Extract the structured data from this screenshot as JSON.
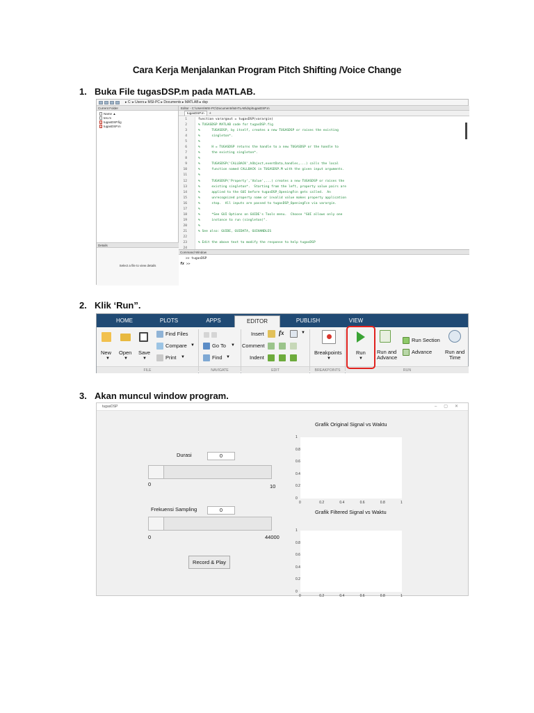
{
  "title": "Cara Kerja Menjalankan Program Pitch Shifting /Voice Change",
  "steps": [
    {
      "num": "1.",
      "text": "Buka File tugasDSP.m pada MATLAB."
    },
    {
      "num": "2.",
      "text": "Klik ‘Run”."
    },
    {
      "num": "3.",
      "text": "Akan muncul window program."
    }
  ],
  "matlab": {
    "address": "▸ C: ▸ Users ▸ MSI-PC ▸ Documents ▸ MATLAB ▸ dsp",
    "current_folder_label": "Current Folder",
    "name_header": "Name ▲",
    "files": [
      "tes.m",
      "tugasDSP.fig",
      "tugasDSP.m"
    ],
    "details_label": "Details",
    "details_msg": "Select a file to view details",
    "editor_title": "Editor - C:\\Users\\MSI-PC\\Documents\\MATLAB\\dsp\\tugasDSP.m",
    "editor_tab": "tugasDSP.m",
    "code_lines": [
      {
        "n": "1",
        "text": "function varargout = tugasDSP(varargin)",
        "kw": true
      },
      {
        "n": "2",
        "text": "% TUGASDSP MATLAB code for tugasDSP.fig",
        "kw": false
      },
      {
        "n": "3",
        "text": "%      TUGASDSP, by itself, creates a new TUGASDSP or raises the existing",
        "kw": false
      },
      {
        "n": "4",
        "text": "%      singleton*.",
        "kw": false
      },
      {
        "n": "5",
        "text": "%",
        "kw": false
      },
      {
        "n": "6",
        "text": "%      H = TUGASDSP returns the handle to a new TUGASDSP or the handle to",
        "kw": false
      },
      {
        "n": "7",
        "text": "%      the existing singleton*.",
        "kw": false
      },
      {
        "n": "8",
        "text": "%",
        "kw": false
      },
      {
        "n": "9",
        "text": "%      TUGASDSP('CALLBACK',hObject,eventData,handles,...) calls the local",
        "kw": false
      },
      {
        "n": "10",
        "text": "%      function named CALLBACK in TUGASDSP.M with the given input arguments.",
        "kw": false
      },
      {
        "n": "11",
        "text": "%",
        "kw": false
      },
      {
        "n": "12",
        "text": "%      TUGASDSP('Property','Value',...) creates a new TUGASDSP or raises the",
        "kw": false
      },
      {
        "n": "13",
        "text": "%      existing singleton*.  Starting from the left, property value pairs are",
        "kw": false
      },
      {
        "n": "14",
        "text": "%      applied to the GUI before tugasDSP_OpeningFcn gets called.  An",
        "kw": false
      },
      {
        "n": "15",
        "text": "%      unrecognized property name or invalid value makes property application",
        "kw": false
      },
      {
        "n": "16",
        "text": "%      stop.  All inputs are passed to tugasDSP_OpeningFcn via varargin.",
        "kw": false
      },
      {
        "n": "17",
        "text": "%",
        "kw": false
      },
      {
        "n": "18",
        "text": "%      *See GUI Options on GUIDE's Tools menu.  Choose \"GUI allows only one",
        "kw": false
      },
      {
        "n": "19",
        "text": "%      instance to run (singleton)\".",
        "kw": false
      },
      {
        "n": "20",
        "text": "%",
        "kw": false
      },
      {
        "n": "21",
        "text": "% See also: GUIDE, GUIDATA, GUIHANDLES",
        "kw": false
      },
      {
        "n": "22",
        "text": "",
        "kw": false
      },
      {
        "n": "23",
        "text": "% Edit the above text to modify the response to help tugasDSP",
        "kw": false
      },
      {
        "n": "24",
        "text": "",
        "kw": false
      }
    ],
    "command_window_label": "Command Window",
    "cmd_line1": ">> tugasDSP",
    "cmd_prompt": ">>",
    "fx": "fx"
  },
  "ribbon": {
    "tabs": [
      "HOME",
      "PLOTS",
      "APPS",
      "EDITOR",
      "PUBLISH",
      "VIEW"
    ],
    "active_tab": "EDITOR",
    "file": {
      "new": "New",
      "open": "Open",
      "save": "Save",
      "find_files": "Find Files",
      "compare": "Compare",
      "print": "Print",
      "group": "FILE"
    },
    "navigate": {
      "go_to": "Go To",
      "find": "Find",
      "group": "NAVIGATE"
    },
    "edit": {
      "insert": "Insert",
      "comment": "Comment",
      "indent": "Indent",
      "fx": "fx",
      "group": "EDIT"
    },
    "breakpoints": {
      "label": "Breakpoints",
      "group": "BREAKPOINTS"
    },
    "run": {
      "run": "Run",
      "run_and_advance_1": "Run and",
      "run_and_advance_2": "Advance",
      "run_section": "Run Section",
      "advance": "Advance",
      "run_and_time_1": "Run and",
      "run_and_time_2": "Time",
      "group": "RUN"
    },
    "colors": {
      "tab_bar": "#204a74",
      "highlight": "#e0201c",
      "play": "#3aa335"
    }
  },
  "gui": {
    "window_title": "tugasDSP",
    "durasi_label": "Durasi",
    "durasi_value": "0",
    "durasi_min": "0",
    "durasi_max": "10",
    "durasi_level": 0,
    "fs_label": "Frekuensi Sampling",
    "fs_value": "0",
    "fs_min": "0",
    "fs_max": "44000",
    "fs_level": 0,
    "button": "Record & Play"
  },
  "chart_data": [
    {
      "type": "line",
      "title": "Grafik Original Signal vs Waktu",
      "xlabel": "",
      "ylabel": "",
      "xlim": [
        0,
        1
      ],
      "ylim": [
        0,
        1
      ],
      "xticks": [
        "0",
        "0.2",
        "0.4",
        "0.6",
        "0.8",
        "1"
      ],
      "yticks": [
        "0",
        "0.2",
        "0.4",
        "0.6",
        "0.8",
        "1"
      ],
      "series": []
    },
    {
      "type": "line",
      "title": "Grafik Filtered Signal vs Waktu",
      "xlabel": "",
      "ylabel": "",
      "xlim": [
        0,
        1
      ],
      "ylim": [
        0,
        1
      ],
      "xticks": [
        "0",
        "0.2",
        "0.4",
        "0.6",
        "0.8",
        "1"
      ],
      "yticks": [
        "0",
        "0.2",
        "0.4",
        "0.6",
        "0.8",
        "1"
      ],
      "series": []
    }
  ]
}
